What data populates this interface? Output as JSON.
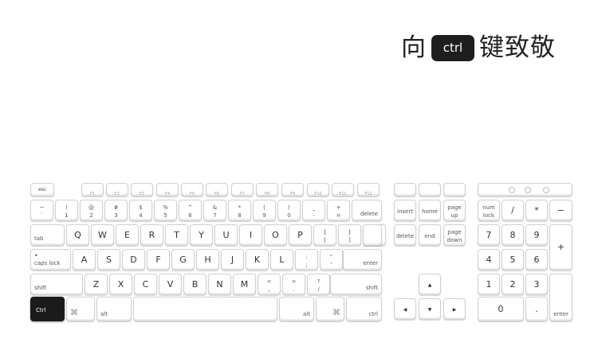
{
  "title": {
    "before": "向",
    "badge": "ctrl",
    "after": "键致敬"
  },
  "function_row": [
    "esc",
    "F1",
    "F2",
    "F3",
    "F4",
    "F5",
    "F6",
    "F7",
    "F8",
    "F9",
    "F10",
    "F11",
    "F12"
  ],
  "number_row": [
    {
      "top": "~",
      "bottom": "`"
    },
    {
      "top": "!",
      "bottom": "1"
    },
    {
      "top": "@",
      "bottom": "2"
    },
    {
      "top": "#",
      "bottom": "3"
    },
    {
      "top": "$",
      "bottom": "4"
    },
    {
      "top": "%",
      "bottom": "5"
    },
    {
      "top": "^",
      "bottom": "6"
    },
    {
      "top": "&",
      "bottom": "7"
    },
    {
      "top": "*",
      "bottom": "8"
    },
    {
      "top": "(",
      "bottom": "9"
    },
    {
      "top": ")",
      "bottom": "0"
    },
    {
      "top": "_",
      "bottom": "-"
    },
    {
      "top": "+",
      "bottom": "="
    }
  ],
  "delete_label": "delete",
  "tab_label": "tab",
  "qwerty_row": [
    "Q",
    "W",
    "E",
    "R",
    "T",
    "Y",
    "U",
    "I",
    "O",
    "P"
  ],
  "qwerty_symbols": [
    {
      "top": "{",
      "bottom": "["
    },
    {
      "top": "}",
      "bottom": "]"
    },
    {
      "top": "|",
      "bottom": "\\"
    }
  ],
  "caps_label": "caps lock",
  "home_row": [
    "A",
    "S",
    "D",
    "F",
    "G",
    "H",
    "J",
    "K",
    "L"
  ],
  "home_symbols": [
    {
      "top": ":",
      "bottom": ";"
    },
    {
      "top": "\"",
      "bottom": "'"
    }
  ],
  "enter_label": "enter",
  "shift_label": "shift",
  "bottom_row_letters": [
    "Z",
    "X",
    "C",
    "V",
    "B",
    "N",
    "M"
  ],
  "bottom_symbols": [
    {
      "top": "<",
      "bottom": ","
    },
    {
      "top": ">",
      "bottom": "."
    },
    {
      "top": "?",
      "bottom": "/"
    }
  ],
  "ctrl_label": "Ctrl",
  "alt_label": "alt",
  "cmd_symbol": "⌘",
  "ctrl_right_label": "ctrl",
  "nav_keys": {
    "insert": "insert",
    "home": "home",
    "page_up": [
      "page",
      "up"
    ],
    "delete": "delete",
    "end": "end",
    "page_down": [
      "page",
      "down"
    ]
  },
  "arrows": {
    "up": "▲",
    "left": "◀",
    "down": "▼",
    "right": "▶"
  },
  "numpad": {
    "num_lock": [
      "num",
      "lock"
    ],
    "slash": "/",
    "star": "*",
    "minus": "−",
    "digits": [
      "7",
      "8",
      "9",
      "4",
      "5",
      "6",
      "1",
      "2",
      "3",
      "0"
    ],
    "plus": "+",
    "dot": ".",
    "enter": "enter"
  }
}
